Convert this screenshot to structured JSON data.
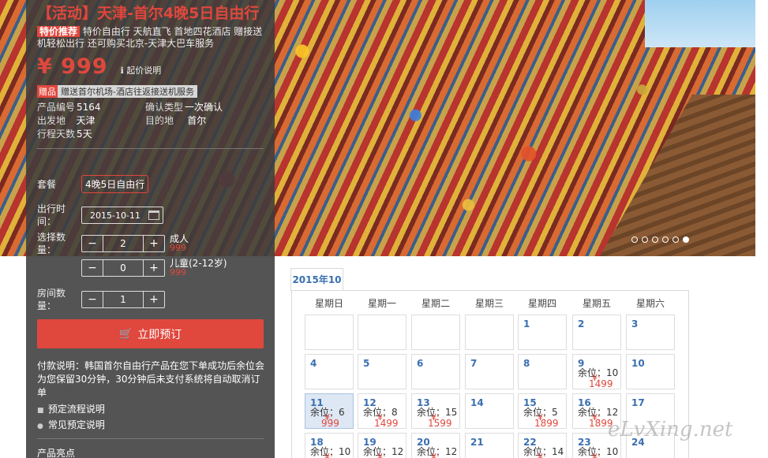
{
  "product": {
    "title": "【活动】天津-首尔4晚5日自由行",
    "tag": "特价推荐",
    "tagline": "特价自由行 天航直飞 首地四花酒店 赠接送机轻松出行 还可购买北京-天津大巴车服务",
    "price": "¥ 999",
    "price_note": "起价说明",
    "gift_label": "赠品",
    "gift_text": "赠送首尔机场-酒店往返接送机服务",
    "meta": [
      {
        "k": "产品编号",
        "v": "5164"
      },
      {
        "k": "确认类型",
        "v": "一次确认"
      },
      {
        "k": "出发地",
        "v": "天津"
      },
      {
        "k": "目的地",
        "v": "首尔"
      },
      {
        "k": "行程天数",
        "v": "5天"
      }
    ]
  },
  "form": {
    "package_label": "套餐",
    "package_value": "4晚5日自由行",
    "date_label": "出行时间：",
    "date_value": "2015-10-11",
    "qty_label": "选择数量：",
    "adult": {
      "value": "2",
      "label": "成人",
      "price": "999"
    },
    "child": {
      "value": "0",
      "label": "儿童(2-12岁)",
      "price": "999"
    },
    "room_label": "房间数量：",
    "room_value": "1",
    "minus": "−",
    "plus": "+",
    "book_label": "立即预订",
    "book_icon": "cart-icon"
  },
  "info": {
    "pay_text": "付款说明：韩国首尔自由行产品在您下单成功后余位会为您保留30分钟，30分钟后未支付系统将自动取消订单",
    "link1": "预定流程说明",
    "link2": "常见预定说明",
    "highlights": "产品亮点"
  },
  "calendar": {
    "month_tab": "2015年10",
    "weekdays": [
      "星期日",
      "星期一",
      "星期二",
      "星期三",
      "星期四",
      "星期五",
      "星期六"
    ],
    "cells": [
      {
        "d": ""
      },
      {
        "d": ""
      },
      {
        "d": ""
      },
      {
        "d": ""
      },
      {
        "d": "1"
      },
      {
        "d": "2"
      },
      {
        "d": "3"
      },
      {
        "d": "4"
      },
      {
        "d": "5"
      },
      {
        "d": "6"
      },
      {
        "d": "7"
      },
      {
        "d": "8"
      },
      {
        "d": "9",
        "s": "余位：10",
        "p": "1499"
      },
      {
        "d": "10"
      },
      {
        "d": "11",
        "s": "余位：6",
        "p": "999",
        "sel": true
      },
      {
        "d": "12",
        "s": "余位：8",
        "p": "1499"
      },
      {
        "d": "13",
        "s": "余位：15",
        "p": "1599"
      },
      {
        "d": "14"
      },
      {
        "d": "15",
        "s": "余位：5",
        "p": "1899"
      },
      {
        "d": "16",
        "s": "余位：12",
        "p": "1899"
      },
      {
        "d": "17"
      },
      {
        "d": "18",
        "s": "余位：10",
        "p": ""
      },
      {
        "d": "19",
        "s": "余位：12",
        "p": ""
      },
      {
        "d": "20",
        "s": "余位：12",
        "p": ""
      },
      {
        "d": "21"
      },
      {
        "d": "22",
        "s": "余位：14",
        "p": ""
      },
      {
        "d": "23",
        "s": "余位：10",
        "p": ""
      },
      {
        "d": "24"
      }
    ]
  },
  "watermark": "eLvXing.net",
  "colors": {
    "accent": "#e0473d",
    "link": "#3a6fb0",
    "panel": "#3c3c3c"
  }
}
